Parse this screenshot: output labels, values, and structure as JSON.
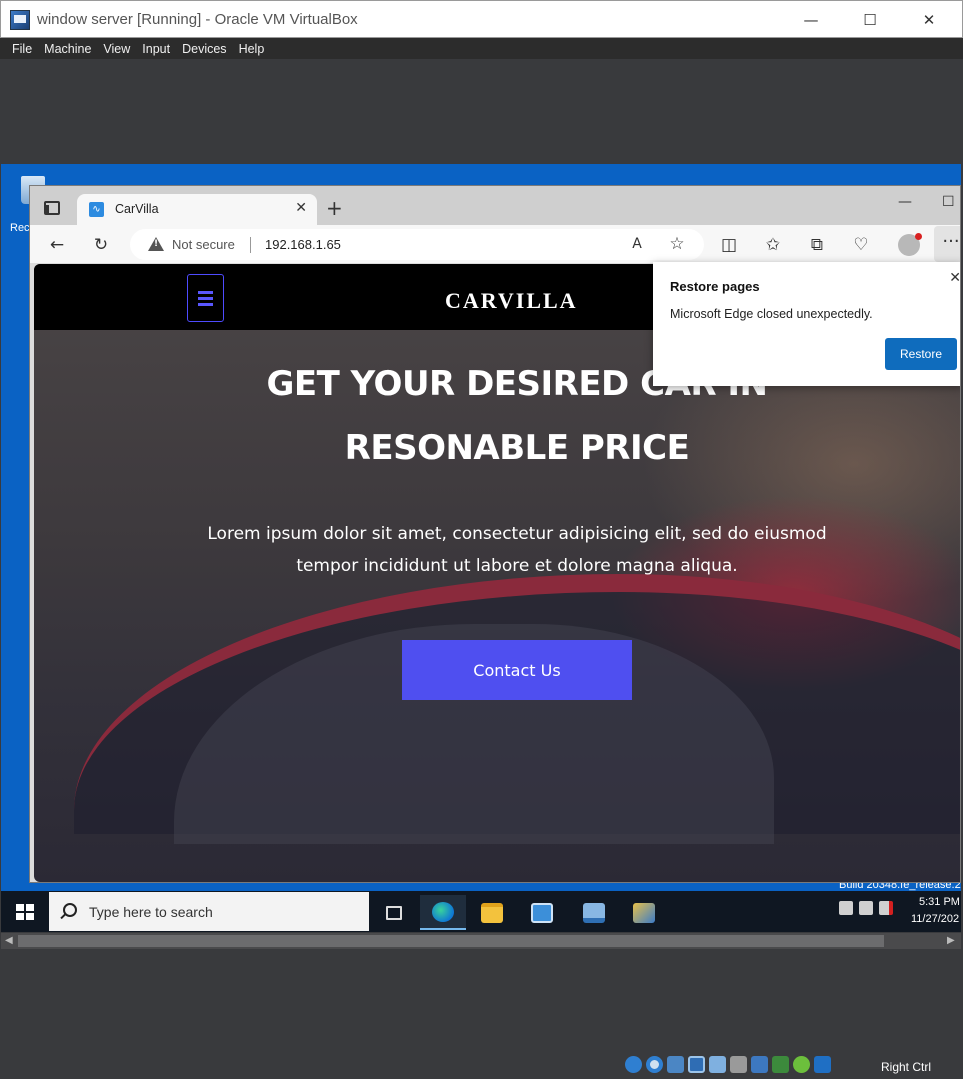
{
  "host": {
    "window_title": "window server [Running] - Oracle VM VirtualBox",
    "controls": {
      "minimize": "—",
      "maximize": "☐",
      "close": "✕"
    },
    "menu": [
      "File",
      "Machine",
      "View",
      "Input",
      "Devices",
      "Help"
    ],
    "status": {
      "host_key": "Right Ctrl"
    }
  },
  "guest": {
    "desktop_icon_label": "Rec",
    "build_text": "Build 20348.fe_release.2",
    "taskbar": {
      "search_placeholder": "Type here to search",
      "clock_time": "5:31 PM",
      "clock_date": "11/27/202"
    }
  },
  "browser": {
    "tab_title": "CarVilla",
    "tab_close": "✕",
    "new_tab": "+",
    "window_controls": {
      "minimize": "—",
      "maximize": "☐"
    },
    "security_label": "Not secure",
    "url": "192.168.1.65",
    "more_button": "···",
    "restore_popup": {
      "title": "Restore pages",
      "message": "Microsoft Edge closed unexpectedly.",
      "button": "Restore",
      "close": "✕"
    }
  },
  "webpage": {
    "brand": "CARVILLA",
    "hero_line1": "GET YOUR DESIRED CAR IN",
    "hero_line2": "RESONABLE PRICE",
    "hero_text": "Lorem ipsum dolor sit amet, consectetur adipisicing elit, sed do eiusmod tempor incididunt ut labore et dolore magna aliqua.",
    "cta": "Contact Us"
  },
  "colors": {
    "vbox_background": "#393a3d",
    "guest_desktop": "#0a62c4",
    "cta_button": "#4f4ff0",
    "restore_button": "#0f6cbd"
  }
}
